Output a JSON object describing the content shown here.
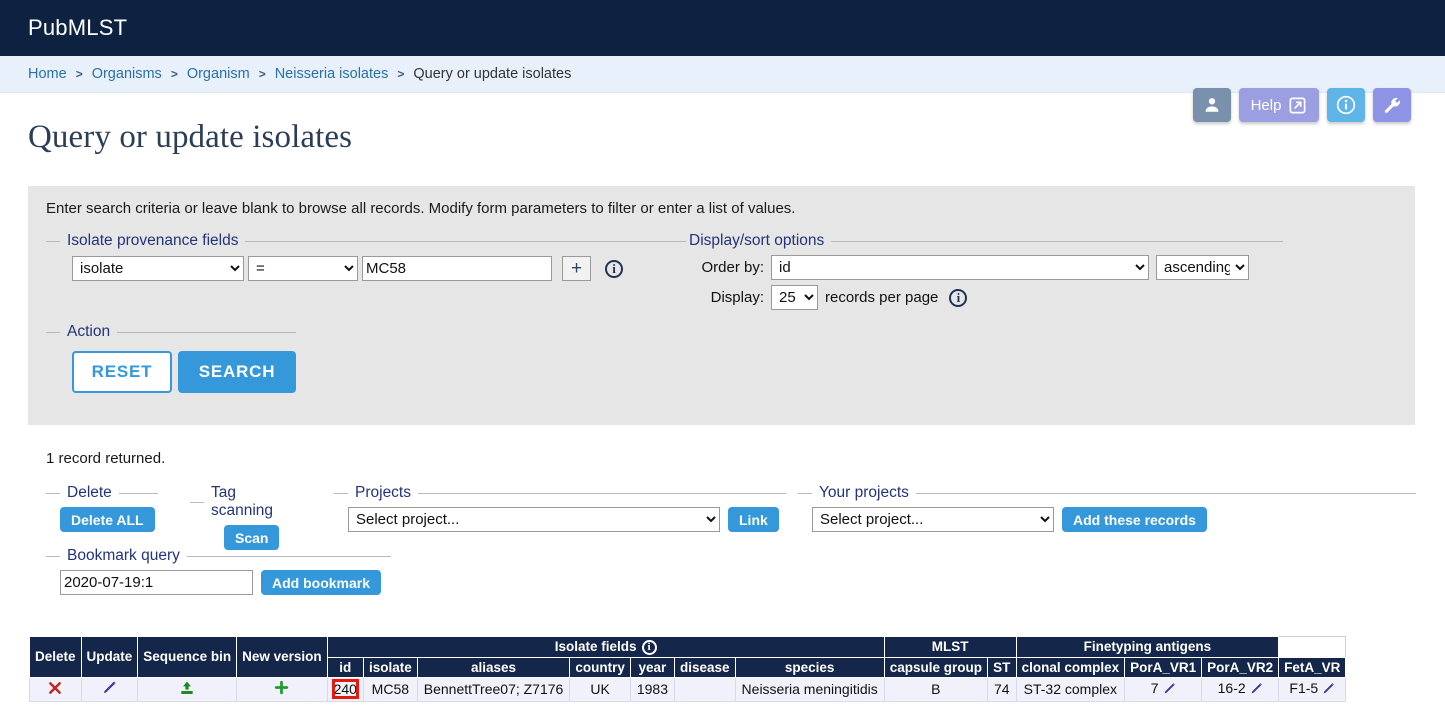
{
  "header": {
    "brand": "PubMLST"
  },
  "breadcrumb": {
    "items": [
      "Home",
      "Organisms",
      "Organism",
      "Neisseria isolates",
      "Query or update isolates"
    ],
    "separator": ">"
  },
  "top_icons": [
    {
      "name": "user-icon",
      "label": ""
    },
    {
      "name": "help-icon",
      "label": "Help"
    },
    {
      "name": "info-icon",
      "label": ""
    },
    {
      "name": "wrench-icon",
      "label": ""
    }
  ],
  "page": {
    "title": "Query or update isolates",
    "blurb": "Enter search criteria or leave blank to browse all records. Modify form parameters to filter or enter a list of values.",
    "records_returned": "1 record returned."
  },
  "provenance": {
    "legend": "Isolate provenance fields",
    "field_value": "isolate",
    "operator_value": "=",
    "search_value": "MC58",
    "search_placeholder": "",
    "add_button": "+",
    "info": "i"
  },
  "display_options": {
    "legend": "Display/sort options",
    "order_by_label": "Order by:",
    "order_by_value": "id",
    "direction_value": "ascending",
    "display_label": "Display:",
    "display_value": "25",
    "per_page_label": "records per page",
    "info": "i"
  },
  "action": {
    "legend": "Action",
    "reset_label": "RESET",
    "search_label": "SEARCH"
  },
  "delete_section": {
    "legend": "Delete",
    "button_label": "Delete ALL"
  },
  "tag_scanning": {
    "legend": "Tag scanning",
    "button_label": "Scan"
  },
  "projects": {
    "legend": "Projects",
    "select_value": "Select project...",
    "link_label": "Link"
  },
  "your_projects": {
    "legend": "Your projects",
    "select_value": "Select project...",
    "add_label": "Add these records"
  },
  "bookmark": {
    "legend": "Bookmark query",
    "input_value": "2020-07-19:1",
    "button_label": "Add bookmark"
  },
  "results_table": {
    "action_headers": [
      "Delete",
      "Update",
      "Sequence bin",
      "New version"
    ],
    "group_headers": [
      {
        "label": "Isolate fields",
        "has_info": true,
        "span": 7
      },
      {
        "label": "MLST",
        "has_info": false,
        "span": 2
      },
      {
        "label": "Finetyping antigens",
        "has_info": false,
        "span": 3
      }
    ],
    "field_headers": [
      "id",
      "isolate",
      "aliases",
      "country",
      "year",
      "disease",
      "species",
      "capsule group",
      "ST",
      "clonal complex",
      "PorA_VR1",
      "PorA_VR2",
      "FetA_VR"
    ],
    "row": {
      "delete_icon": "red-cross-icon",
      "update_icon": "pencil-icon",
      "sequence_bin_icon": "upload-icon",
      "new_version_icon": "green-plus-icon",
      "id": "240",
      "isolate": "MC58",
      "aliases": "BennettTree07; Z7176",
      "country": "UK",
      "year": "1983",
      "disease": "",
      "species": "Neisseria meningitidis",
      "capsule_group": "B",
      "ST": "74",
      "clonal_complex": "ST-32 complex",
      "PorA_VR1": "7",
      "PorA_VR2": "16-2",
      "FetA_VR": "F1-5"
    }
  },
  "colors": {
    "header_bg": "#0d2240",
    "breadcrumb_bg": "#e8f1fb",
    "panel_bg": "#e6e6e6",
    "accent_blue": "#3498db",
    "legend_blue": "#22347a",
    "table_header_bg": "#14264a",
    "table_row_bg": "#f1f1fb",
    "highlight_red": "#e8180c",
    "id_link": "#2a2aca"
  }
}
